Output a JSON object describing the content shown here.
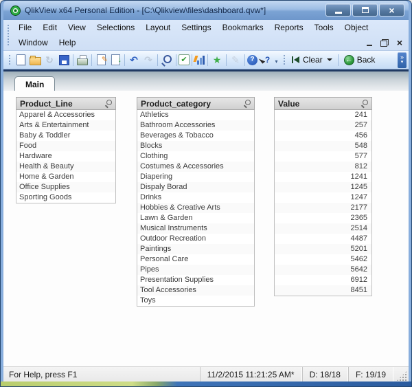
{
  "window": {
    "title": "QlikView x64 Personal Edition - [C:\\Qlikview\\files\\dashboard.qvw*]"
  },
  "menubar": {
    "row1": [
      "File",
      "Edit",
      "View",
      "Selections",
      "Layout",
      "Settings",
      "Bookmarks",
      "Reports",
      "Tools",
      "Object"
    ],
    "row2": [
      "Window",
      "Help"
    ]
  },
  "toolbar": {
    "clear_label": "Clear",
    "back_label": "Back",
    "buttons": [
      {
        "name": "new-document-icon",
        "shape": "page"
      },
      {
        "name": "open-file-icon",
        "shape": "folder"
      },
      {
        "name": "refresh-icon",
        "shape": "glyph",
        "glyph": "↻",
        "color": "#9fa8b5",
        "disabled": true
      },
      {
        "name": "save-icon",
        "shape": "floppy"
      },
      {
        "shape": "sep"
      },
      {
        "name": "print-icon",
        "shape": "printer"
      },
      {
        "shape": "sep"
      },
      {
        "name": "edit-script-icon",
        "shape": "editscript"
      },
      {
        "name": "reload-data-icon",
        "shape": "reloaddoc"
      },
      {
        "shape": "sep"
      },
      {
        "name": "undo-icon",
        "shape": "glyph",
        "glyph": "↶",
        "color": "#2d5fc0"
      },
      {
        "name": "redo-icon",
        "shape": "glyph",
        "glyph": "↷",
        "color": "#a9b4c4",
        "disabled": true
      },
      {
        "shape": "sep"
      },
      {
        "name": "search-icon",
        "shape": "magnifier"
      },
      {
        "shape": "sep"
      },
      {
        "name": "current-selections-icon",
        "shape": "checkbox",
        "glyph": "✔"
      },
      {
        "shape": "sep"
      },
      {
        "name": "quick-chart-wizard-icon",
        "shape": "chart"
      },
      {
        "shape": "sep"
      },
      {
        "name": "add-bookmark-icon",
        "shape": "glyph",
        "glyph": "★",
        "color": "#3fae49"
      },
      {
        "shape": "sep"
      },
      {
        "name": "notes-icon",
        "shape": "glyph",
        "glyph": "✎",
        "color": "#b4bcc8",
        "disabled": true
      },
      {
        "shape": "sep"
      },
      {
        "name": "help-icon",
        "shape": "help",
        "glyph": "?"
      },
      {
        "name": "context-help-icon",
        "shape": "ctxhelp",
        "glyph": "?"
      }
    ]
  },
  "tabs": [
    {
      "label": "Main"
    }
  ],
  "listboxes": [
    {
      "title": "Product_Line",
      "items": [
        "Apparel & Accessories",
        "Arts & Entertainment",
        "Baby & Toddler",
        "Food",
        "Hardware",
        "Health & Beauty",
        "Home & Garden",
        "Office Supplies",
        "Sporting Goods"
      ]
    },
    {
      "title": "Product_category",
      "items": [
        "Athletics",
        "Bathroom Accessories",
        "Beverages & Tobacco",
        "Blocks",
        "Clothing",
        "Costumes & Accessories",
        "Diapering",
        "Dispaly Borad",
        "Drinks",
        "Hobbies & Creative Arts",
        "Lawn & Garden",
        "Musical Instruments",
        "Outdoor Recreation",
        "Paintings",
        "Personal Care",
        "Pipes",
        "Presentation Supplies",
        "Tool Accessories",
        "Toys"
      ]
    },
    {
      "title": "Value",
      "items": [
        "241",
        "257",
        "456",
        "548",
        "577",
        "812",
        "1241",
        "1245",
        "1247",
        "2177",
        "2365",
        "2514",
        "4487",
        "5201",
        "5462",
        "5642",
        "6912",
        "8451"
      ]
    }
  ],
  "statusbar": {
    "help_text": "For Help, press F1",
    "panels": [
      "11/2/2015 11:21:25 AM*",
      "D: 18/18",
      "F: 19/19"
    ]
  },
  "colors": {
    "titlebar_blue": "#7ba3d4",
    "menu_blue": "#d4e3f8",
    "accent_green": "#3fae49",
    "frame_blue": "#88aedd",
    "dark_separator": "#203a63"
  }
}
